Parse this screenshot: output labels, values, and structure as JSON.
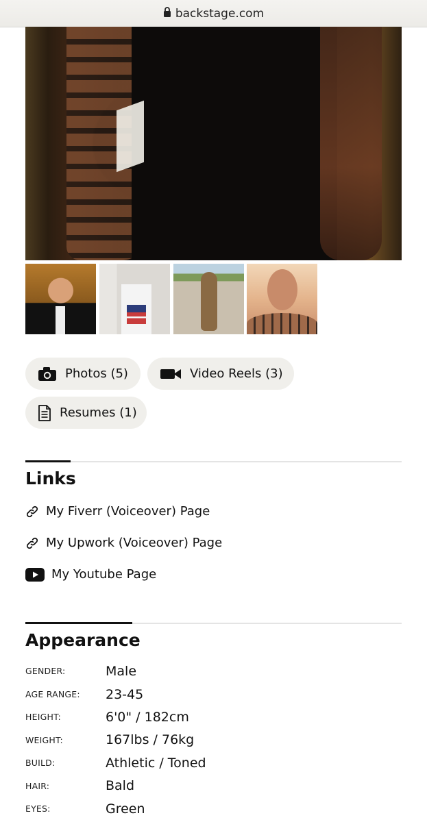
{
  "browser": {
    "url": "backstage.com"
  },
  "media": {
    "photos_label": "Photos (5)",
    "video_label": "Video Reels (3)",
    "resumes_label": "Resumes (1)"
  },
  "links": {
    "title": "Links",
    "items": [
      {
        "label": "My Fiverr (Voiceover) Page",
        "icon": "link-icon"
      },
      {
        "label": "My Upwork (Voiceover) Page",
        "icon": "link-icon"
      },
      {
        "label": "My Youtube Page",
        "icon": "youtube-icon"
      }
    ]
  },
  "appearance": {
    "title": "Appearance",
    "rows": [
      {
        "label": "GENDER:",
        "value": "Male"
      },
      {
        "label": "AGE RANGE:",
        "value": "23-45"
      },
      {
        "label": "HEIGHT:",
        "value": "6'0\" / 182cm"
      },
      {
        "label": "WEIGHT:",
        "value": "167lbs / 76kg"
      },
      {
        "label": "BUILD:",
        "value": "Athletic / Toned"
      },
      {
        "label": "HAIR:",
        "value": "Bald"
      },
      {
        "label": "EYES:",
        "value": "Green"
      }
    ]
  }
}
